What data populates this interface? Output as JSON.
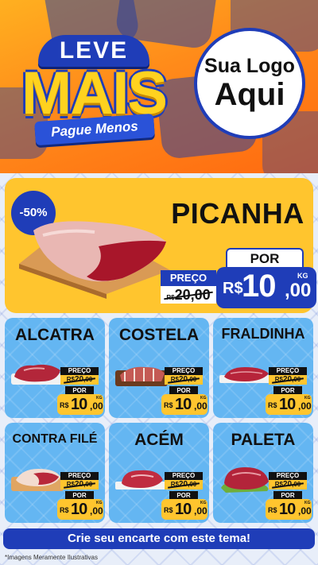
{
  "header": {
    "logo": {
      "top": "LEVE",
      "main": "MAIS",
      "bottom": "Pague Menos"
    },
    "brand_placeholder": {
      "line1": "Sua Logo",
      "line2": "Aqui"
    }
  },
  "featured": {
    "discount": "-50%",
    "name": "PICANHA",
    "preco_label": "PREÇO",
    "old_price_currency": "R$",
    "old_price": "20,00",
    "por_label": "POR",
    "currency": "R$",
    "price_int": "10",
    "price_dec": ",00",
    "unit": "KG"
  },
  "products": [
    {
      "name": "ALCATRA",
      "preco_label": "PREÇO",
      "old_currency": "R$",
      "old_price": "20",
      "old_dec": ",00",
      "por_label": "POR",
      "currency": "R$",
      "price_int": "10",
      "price_dec": ",00",
      "unit": "KG"
    },
    {
      "name": "COSTELA",
      "preco_label": "PREÇO",
      "old_currency": "R$",
      "old_price": "20",
      "old_dec": ",00",
      "por_label": "POR",
      "currency": "R$",
      "price_int": "10",
      "price_dec": ",00",
      "unit": "KG"
    },
    {
      "name": "FRALDINHA",
      "preco_label": "PREÇO",
      "old_currency": "R$",
      "old_price": "20",
      "old_dec": ",00",
      "por_label": "POR",
      "currency": "R$",
      "price_int": "10",
      "price_dec": ",00",
      "unit": "KG"
    },
    {
      "name": "CONTRA FILÉ",
      "preco_label": "PREÇO",
      "old_currency": "R$",
      "old_price": "20",
      "old_dec": ",00",
      "por_label": "POR",
      "currency": "R$",
      "price_int": "10",
      "price_dec": ",00",
      "unit": "KG"
    },
    {
      "name": "ACÉM",
      "preco_label": "PREÇO",
      "old_currency": "R$",
      "old_price": "20",
      "old_dec": ",00",
      "por_label": "POR",
      "currency": "R$",
      "price_int": "10",
      "price_dec": ",00",
      "unit": "KG"
    },
    {
      "name": "PALETA",
      "preco_label": "PREÇO",
      "old_currency": "R$",
      "old_price": "20",
      "old_dec": ",00",
      "por_label": "POR",
      "currency": "R$",
      "price_int": "10",
      "price_dec": ",00",
      "unit": "KG"
    }
  ],
  "cta": "Crie seu encarte com este tema!",
  "disclaimer": "*Imagens Meramente Ilustrativas",
  "colors": {
    "brand_blue": "#1f3db8",
    "accent_yellow": "#ffc52e",
    "card_blue": "#64b6f2",
    "header_orange": "#ff8a1a"
  }
}
